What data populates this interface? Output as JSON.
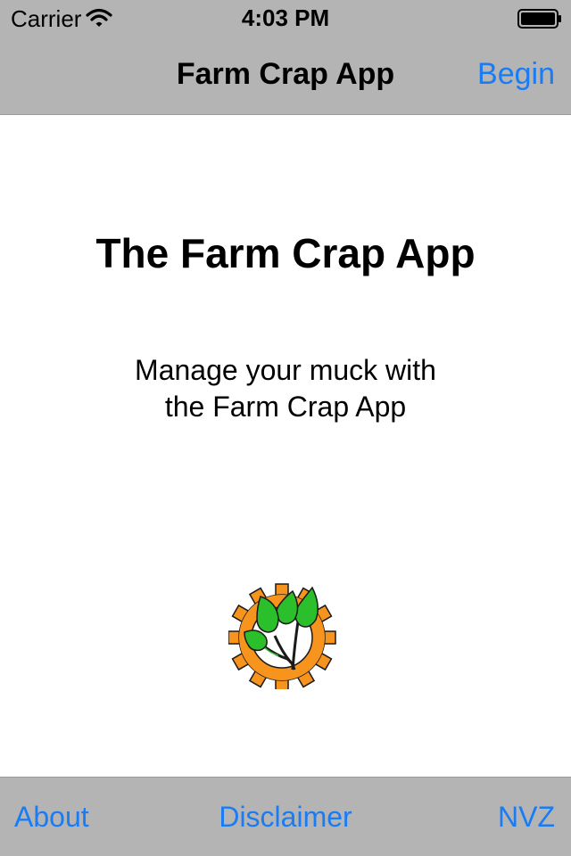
{
  "status_bar": {
    "carrier": "Carrier",
    "time": "4:03 PM",
    "wifi_icon": "wifi-icon",
    "battery_icon": "battery-icon"
  },
  "nav_bar": {
    "title": "Farm Crap App",
    "right_button": "Begin"
  },
  "main": {
    "headline": "The Farm Crap App",
    "tagline_line1": "Manage your muck with",
    "tagline_line2": "the Farm Crap App",
    "logo_icon": "gear-with-leaves-logo"
  },
  "toolbar": {
    "about": "About",
    "disclaimer": "Disclaimer",
    "nvz": "NVZ"
  },
  "colors": {
    "bar_background": "#b4b4b4",
    "accent": "#1a7cf5",
    "gear_orange": "#f7941d",
    "leaf_green": "#2bbf2b"
  }
}
